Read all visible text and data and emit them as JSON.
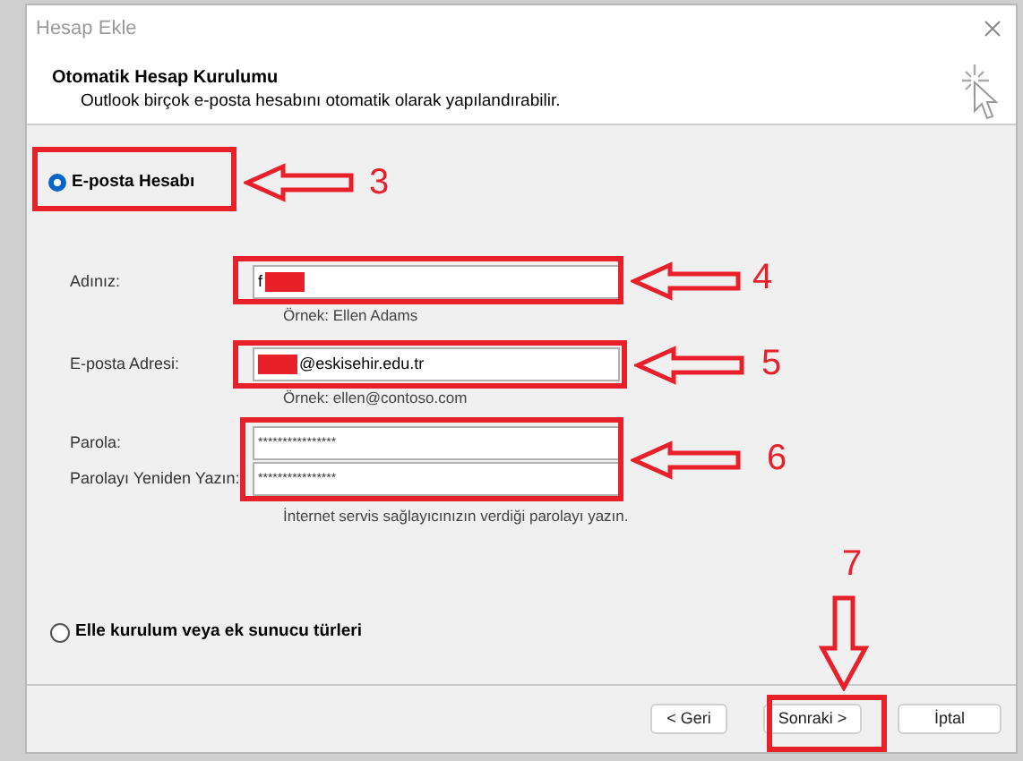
{
  "window": {
    "title": "Hesap Ekle"
  },
  "header": {
    "title": "Otomatik Hesap Kurulumu",
    "subtitle": "Outlook birçok e-posta hesabını otomatik olarak yapılandırabilir."
  },
  "options": [
    {
      "label": "E-posta Hesabı",
      "selected": true
    },
    {
      "label": "Elle kurulum veya ek sunucu türleri",
      "selected": false
    }
  ],
  "fields": [
    {
      "label": "Adınız:",
      "value": "f",
      "kind": "text",
      "redacted": true,
      "hint": "Örnek: Ellen Adams"
    },
    {
      "label": "E-posta Adresi:",
      "value": "@eskisehir.edu.tr",
      "kind": "text",
      "redacted": true,
      "hint": "Örnek: ellen@contoso.com"
    },
    {
      "label": "Parola:",
      "value": "****************",
      "kind": "password",
      "redacted": false
    },
    {
      "label": "Parolayı Yeniden Yazın:",
      "value": "****************",
      "kind": "password",
      "redacted": false,
      "hint": "İnternet servis sağlayıcınızın verdiği parolayı yazın."
    }
  ],
  "buttons": [
    {
      "label": "< Geri"
    },
    {
      "label": "Sonraki >"
    },
    {
      "label": "İptal"
    }
  ],
  "annotations": [
    {
      "number": "3"
    },
    {
      "number": "4"
    },
    {
      "number": "5"
    },
    {
      "number": "6"
    },
    {
      "number": "7"
    }
  ]
}
